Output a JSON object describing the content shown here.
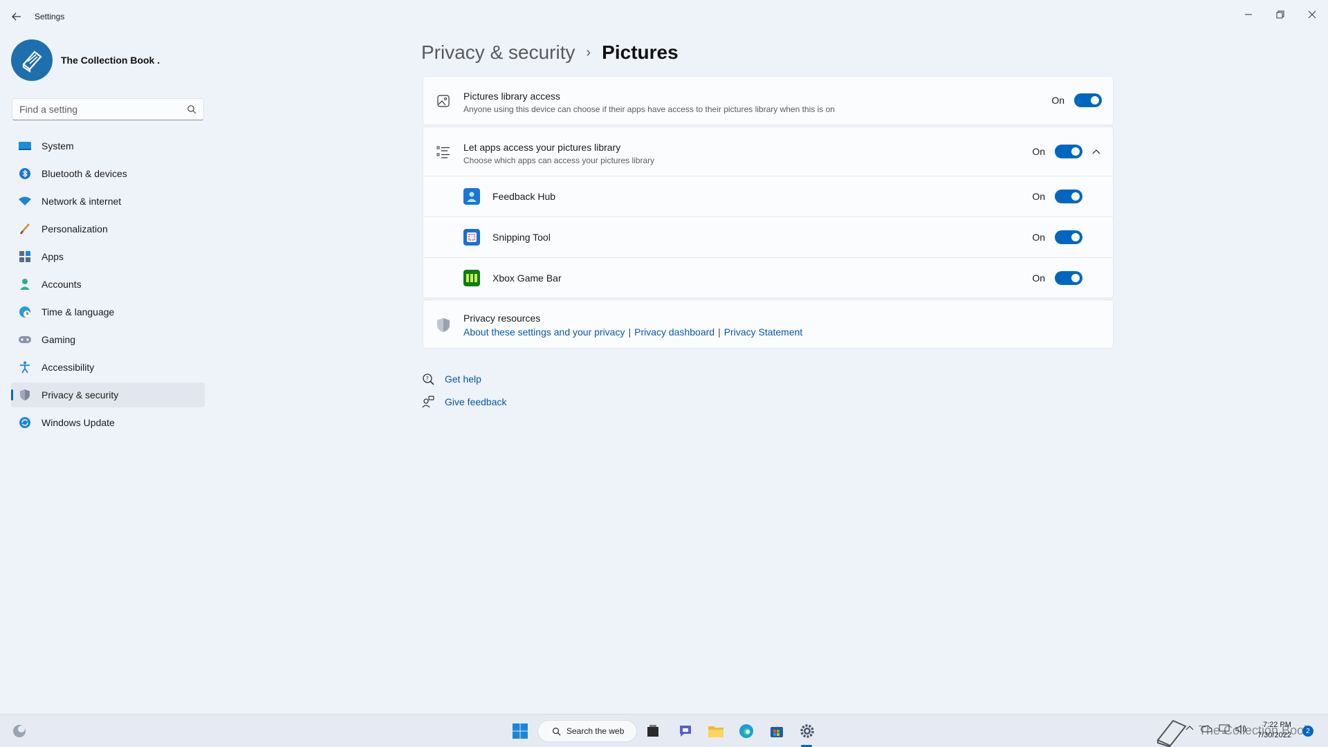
{
  "window": {
    "title": "Settings"
  },
  "profile": {
    "name": "The Collection Book ."
  },
  "search": {
    "placeholder": "Find a setting"
  },
  "sidebar": {
    "items": [
      {
        "label": "System",
        "icon": "system-icon"
      },
      {
        "label": "Bluetooth & devices",
        "icon": "bluetooth-icon"
      },
      {
        "label": "Network & internet",
        "icon": "wifi-icon"
      },
      {
        "label": "Personalization",
        "icon": "brush-icon"
      },
      {
        "label": "Apps",
        "icon": "apps-icon"
      },
      {
        "label": "Accounts",
        "icon": "accounts-icon"
      },
      {
        "label": "Time & language",
        "icon": "globe-clock-icon"
      },
      {
        "label": "Gaming",
        "icon": "gamepad-icon"
      },
      {
        "label": "Accessibility",
        "icon": "accessibility-icon"
      },
      {
        "label": "Privacy & security",
        "icon": "shield-icon",
        "active": true
      },
      {
        "label": "Windows Update",
        "icon": "update-icon"
      }
    ]
  },
  "breadcrumb": {
    "parent": "Privacy & security",
    "separator": "›",
    "current": "Pictures"
  },
  "library_access": {
    "title": "Pictures library access",
    "description": "Anyone using this device can choose if their apps have access to their pictures library when this is on",
    "state_label": "On"
  },
  "apps_access": {
    "title": "Let apps access your pictures library",
    "description": "Choose which apps can access your pictures library",
    "state_label": "On",
    "apps": [
      {
        "name": "Feedback Hub",
        "state_label": "On"
      },
      {
        "name": "Snipping Tool",
        "state_label": "On"
      },
      {
        "name": "Xbox Game Bar",
        "state_label": "On"
      }
    ]
  },
  "privacy_resources": {
    "title": "Privacy resources",
    "links": [
      "About these settings and your privacy",
      "Privacy dashboard",
      "Privacy Statement"
    ],
    "separator": "|"
  },
  "help": {
    "get_help": "Get help",
    "give_feedback": "Give feedback"
  },
  "taskbar": {
    "search_label": "Search the web",
    "watermark": "The Collection Book",
    "time": "7:22 PM",
    "date": "7/30/2022",
    "notification_count": "2"
  },
  "colors": {
    "accent": "#0067c0",
    "link": "#0359a8",
    "background": "#eef2f9"
  }
}
